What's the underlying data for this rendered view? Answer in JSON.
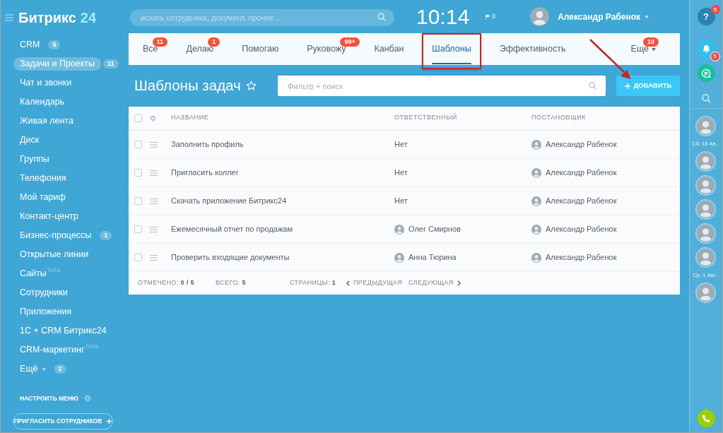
{
  "sidebar": {
    "logo": {
      "name": "Битрикс",
      "suffix": "24"
    },
    "items": [
      {
        "label": "CRM",
        "counter": "5",
        "selected": false,
        "dropdown": false
      },
      {
        "label": "Задачи и Проекты",
        "counter": "11",
        "selected": true,
        "dropdown": false
      },
      {
        "label": "Чат и звонки",
        "selected": false,
        "dropdown": false
      },
      {
        "label": "Календарь",
        "selected": false,
        "dropdown": false
      },
      {
        "label": "Живая лента",
        "selected": false,
        "dropdown": false
      },
      {
        "label": "Диск",
        "selected": false,
        "dropdown": false
      },
      {
        "label": "Группы",
        "selected": false,
        "dropdown": false
      },
      {
        "label": "Телефония",
        "selected": false,
        "dropdown": false
      },
      {
        "label": "Мой тариф",
        "selected": false,
        "dropdown": false
      },
      {
        "label": "Контакт-центр",
        "selected": false,
        "dropdown": false
      },
      {
        "label": "Бизнес-процессы",
        "counter": "1",
        "selected": false,
        "dropdown": false
      },
      {
        "label": "Открытые линии",
        "selected": false,
        "dropdown": false
      },
      {
        "label": "Сайты",
        "tag": "beta",
        "selected": false,
        "dropdown": false
      },
      {
        "label": "Сотрудники",
        "selected": false,
        "dropdown": false
      },
      {
        "label": "Приложения",
        "selected": false,
        "dropdown": false
      },
      {
        "label": "1С + CRM Битрикс24",
        "selected": false,
        "dropdown": false
      },
      {
        "label": "CRM-маркетинг",
        "tag": "beta",
        "selected": false,
        "dropdown": false
      },
      {
        "label": "Ещё",
        "counter": "2",
        "selected": false,
        "dropdown": true
      }
    ],
    "settings_link": "НАСТРОИТЬ МЕНЮ",
    "invite_button": "ПРИГЛАСИТЬ СОТРУДНИКОВ"
  },
  "header": {
    "search": {
      "placeholder": "искать сотрудника, документ, прочее..."
    },
    "clock": "10:14",
    "flag_count": "0",
    "user": {
      "name": "Александр Рабенок"
    }
  },
  "tabs": [
    {
      "label": "Все",
      "counter": "11",
      "selected": false,
      "highlighted": false,
      "dropdown": false
    },
    {
      "label": "Делаю",
      "counter": "1",
      "selected": false,
      "highlighted": false,
      "dropdown": false
    },
    {
      "label": "Помогаю",
      "selected": false,
      "highlighted": false,
      "dropdown": false
    },
    {
      "label": "Руковожу",
      "counter": "99+",
      "selected": false,
      "highlighted": false,
      "dropdown": false
    },
    {
      "label": "Канбан",
      "selected": false,
      "highlighted": false,
      "dropdown": false
    },
    {
      "label": "Шаблоны",
      "selected": true,
      "highlighted": true,
      "dropdown": false
    },
    {
      "label": "Эффективность",
      "selected": false,
      "highlighted": false,
      "dropdown": false
    },
    {
      "label": "Еще",
      "counter": "10",
      "selected": false,
      "highlighted": false,
      "dropdown": true
    }
  ],
  "page": {
    "title": "Шаблоны задач",
    "filter": {
      "placeholder": "Фильтр + поиск"
    },
    "add_button": {
      "label": "ДОБАВИТЬ",
      "pointed_at": true
    }
  },
  "table": {
    "select_all": {
      "checked": false
    },
    "columns": [
      "НАЗВАНИЕ",
      "ОТВЕТСТВЕННЫЙ",
      "ПОСТАНОВЩИК"
    ],
    "rows": [
      {
        "checked": false,
        "name": "Заполнить профиль",
        "responsible": {
          "name": "Нет",
          "avatar": false
        },
        "creator": {
          "name": "Александр Рабенок",
          "avatar": true
        }
      },
      {
        "checked": false,
        "name": "Пригласить коллег",
        "responsible": {
          "name": "Нет",
          "avatar": false
        },
        "creator": {
          "name": "Александр Рабенок",
          "avatar": true
        }
      },
      {
        "checked": false,
        "name": "Скачать приложение Битрикс24",
        "responsible": {
          "name": "Нет",
          "avatar": false
        },
        "creator": {
          "name": "Александр Рабенок",
          "avatar": true
        }
      },
      {
        "checked": false,
        "name": "Ежемесячный отчет по продажам",
        "responsible": {
          "name": "Олег Смирнов",
          "avatar": true
        },
        "creator": {
          "name": "Александр Рабенок",
          "avatar": true
        }
      },
      {
        "checked": false,
        "name": "Проверить входящие документы",
        "responsible": {
          "name": "Анна Тюрина",
          "avatar": true
        },
        "creator": {
          "name": "Александр Рабенок",
          "avatar": true
        }
      }
    ],
    "footer": {
      "selected_count": "ОТМЕЧЕНО: **0 / 5**",
      "total": "ВСЕГО: **5**",
      "pages": "СТРАНИЦЫ: **1**",
      "prev": "ПРЕДЫДУЩАЯ",
      "next": "СЛЕДУЮЩАЯ"
    }
  },
  "right_panel": {
    "help": {
      "label": "?",
      "badge": "5"
    },
    "notifications": {
      "badge": "5"
    },
    "contacts": [
      {
        "kind": "avatar"
      },
      {
        "kind": "date",
        "text": "Сб, 18 Ав..."
      },
      {
        "kind": "avatar"
      },
      {
        "kind": "avatar"
      },
      {
        "kind": "avatar"
      },
      {
        "kind": "avatar"
      },
      {
        "kind": "avatar"
      },
      {
        "kind": "date",
        "text": "Ср, 1 Авг..."
      },
      {
        "kind": "avatar"
      }
    ]
  }
}
